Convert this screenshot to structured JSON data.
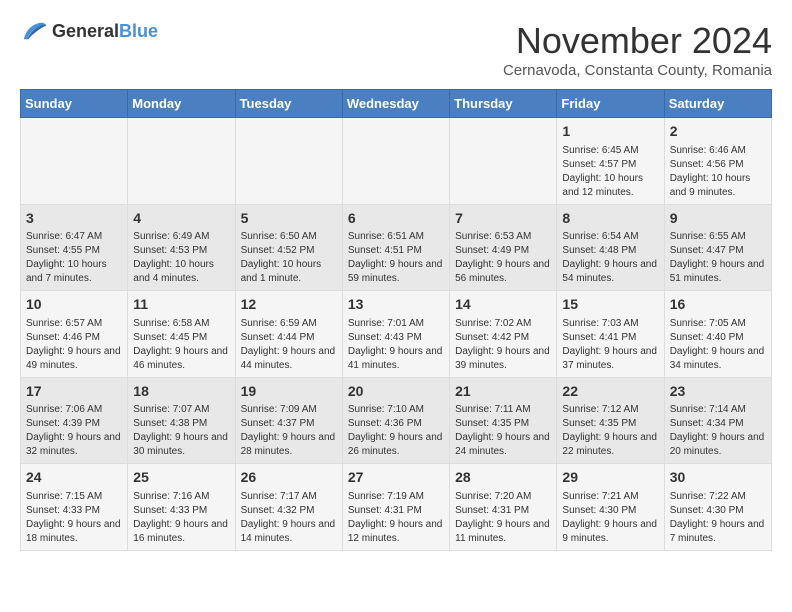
{
  "header": {
    "logo_general": "General",
    "logo_blue": "Blue",
    "title": "November 2024",
    "subtitle": "Cernavoda, Constanta County, Romania"
  },
  "columns": [
    "Sunday",
    "Monday",
    "Tuesday",
    "Wednesday",
    "Thursday",
    "Friday",
    "Saturday"
  ],
  "weeks": [
    [
      {
        "day": "",
        "info": ""
      },
      {
        "day": "",
        "info": ""
      },
      {
        "day": "",
        "info": ""
      },
      {
        "day": "",
        "info": ""
      },
      {
        "day": "",
        "info": ""
      },
      {
        "day": "1",
        "info": "Sunrise: 6:45 AM\nSunset: 4:57 PM\nDaylight: 10 hours and 12 minutes."
      },
      {
        "day": "2",
        "info": "Sunrise: 6:46 AM\nSunset: 4:56 PM\nDaylight: 10 hours and 9 minutes."
      }
    ],
    [
      {
        "day": "3",
        "info": "Sunrise: 6:47 AM\nSunset: 4:55 PM\nDaylight: 10 hours and 7 minutes."
      },
      {
        "day": "4",
        "info": "Sunrise: 6:49 AM\nSunset: 4:53 PM\nDaylight: 10 hours and 4 minutes."
      },
      {
        "day": "5",
        "info": "Sunrise: 6:50 AM\nSunset: 4:52 PM\nDaylight: 10 hours and 1 minute."
      },
      {
        "day": "6",
        "info": "Sunrise: 6:51 AM\nSunset: 4:51 PM\nDaylight: 9 hours and 59 minutes."
      },
      {
        "day": "7",
        "info": "Sunrise: 6:53 AM\nSunset: 4:49 PM\nDaylight: 9 hours and 56 minutes."
      },
      {
        "day": "8",
        "info": "Sunrise: 6:54 AM\nSunset: 4:48 PM\nDaylight: 9 hours and 54 minutes."
      },
      {
        "day": "9",
        "info": "Sunrise: 6:55 AM\nSunset: 4:47 PM\nDaylight: 9 hours and 51 minutes."
      }
    ],
    [
      {
        "day": "10",
        "info": "Sunrise: 6:57 AM\nSunset: 4:46 PM\nDaylight: 9 hours and 49 minutes."
      },
      {
        "day": "11",
        "info": "Sunrise: 6:58 AM\nSunset: 4:45 PM\nDaylight: 9 hours and 46 minutes."
      },
      {
        "day": "12",
        "info": "Sunrise: 6:59 AM\nSunset: 4:44 PM\nDaylight: 9 hours and 44 minutes."
      },
      {
        "day": "13",
        "info": "Sunrise: 7:01 AM\nSunset: 4:43 PM\nDaylight: 9 hours and 41 minutes."
      },
      {
        "day": "14",
        "info": "Sunrise: 7:02 AM\nSunset: 4:42 PM\nDaylight: 9 hours and 39 minutes."
      },
      {
        "day": "15",
        "info": "Sunrise: 7:03 AM\nSunset: 4:41 PM\nDaylight: 9 hours and 37 minutes."
      },
      {
        "day": "16",
        "info": "Sunrise: 7:05 AM\nSunset: 4:40 PM\nDaylight: 9 hours and 34 minutes."
      }
    ],
    [
      {
        "day": "17",
        "info": "Sunrise: 7:06 AM\nSunset: 4:39 PM\nDaylight: 9 hours and 32 minutes."
      },
      {
        "day": "18",
        "info": "Sunrise: 7:07 AM\nSunset: 4:38 PM\nDaylight: 9 hours and 30 minutes."
      },
      {
        "day": "19",
        "info": "Sunrise: 7:09 AM\nSunset: 4:37 PM\nDaylight: 9 hours and 28 minutes."
      },
      {
        "day": "20",
        "info": "Sunrise: 7:10 AM\nSunset: 4:36 PM\nDaylight: 9 hours and 26 minutes."
      },
      {
        "day": "21",
        "info": "Sunrise: 7:11 AM\nSunset: 4:35 PM\nDaylight: 9 hours and 24 minutes."
      },
      {
        "day": "22",
        "info": "Sunrise: 7:12 AM\nSunset: 4:35 PM\nDaylight: 9 hours and 22 minutes."
      },
      {
        "day": "23",
        "info": "Sunrise: 7:14 AM\nSunset: 4:34 PM\nDaylight: 9 hours and 20 minutes."
      }
    ],
    [
      {
        "day": "24",
        "info": "Sunrise: 7:15 AM\nSunset: 4:33 PM\nDaylight: 9 hours and 18 minutes."
      },
      {
        "day": "25",
        "info": "Sunrise: 7:16 AM\nSunset: 4:33 PM\nDaylight: 9 hours and 16 minutes."
      },
      {
        "day": "26",
        "info": "Sunrise: 7:17 AM\nSunset: 4:32 PM\nDaylight: 9 hours and 14 minutes."
      },
      {
        "day": "27",
        "info": "Sunrise: 7:19 AM\nSunset: 4:31 PM\nDaylight: 9 hours and 12 minutes."
      },
      {
        "day": "28",
        "info": "Sunrise: 7:20 AM\nSunset: 4:31 PM\nDaylight: 9 hours and 11 minutes."
      },
      {
        "day": "29",
        "info": "Sunrise: 7:21 AM\nSunset: 4:30 PM\nDaylight: 9 hours and 9 minutes."
      },
      {
        "day": "30",
        "info": "Sunrise: 7:22 AM\nSunset: 4:30 PM\nDaylight: 9 hours and 7 minutes."
      }
    ]
  ]
}
